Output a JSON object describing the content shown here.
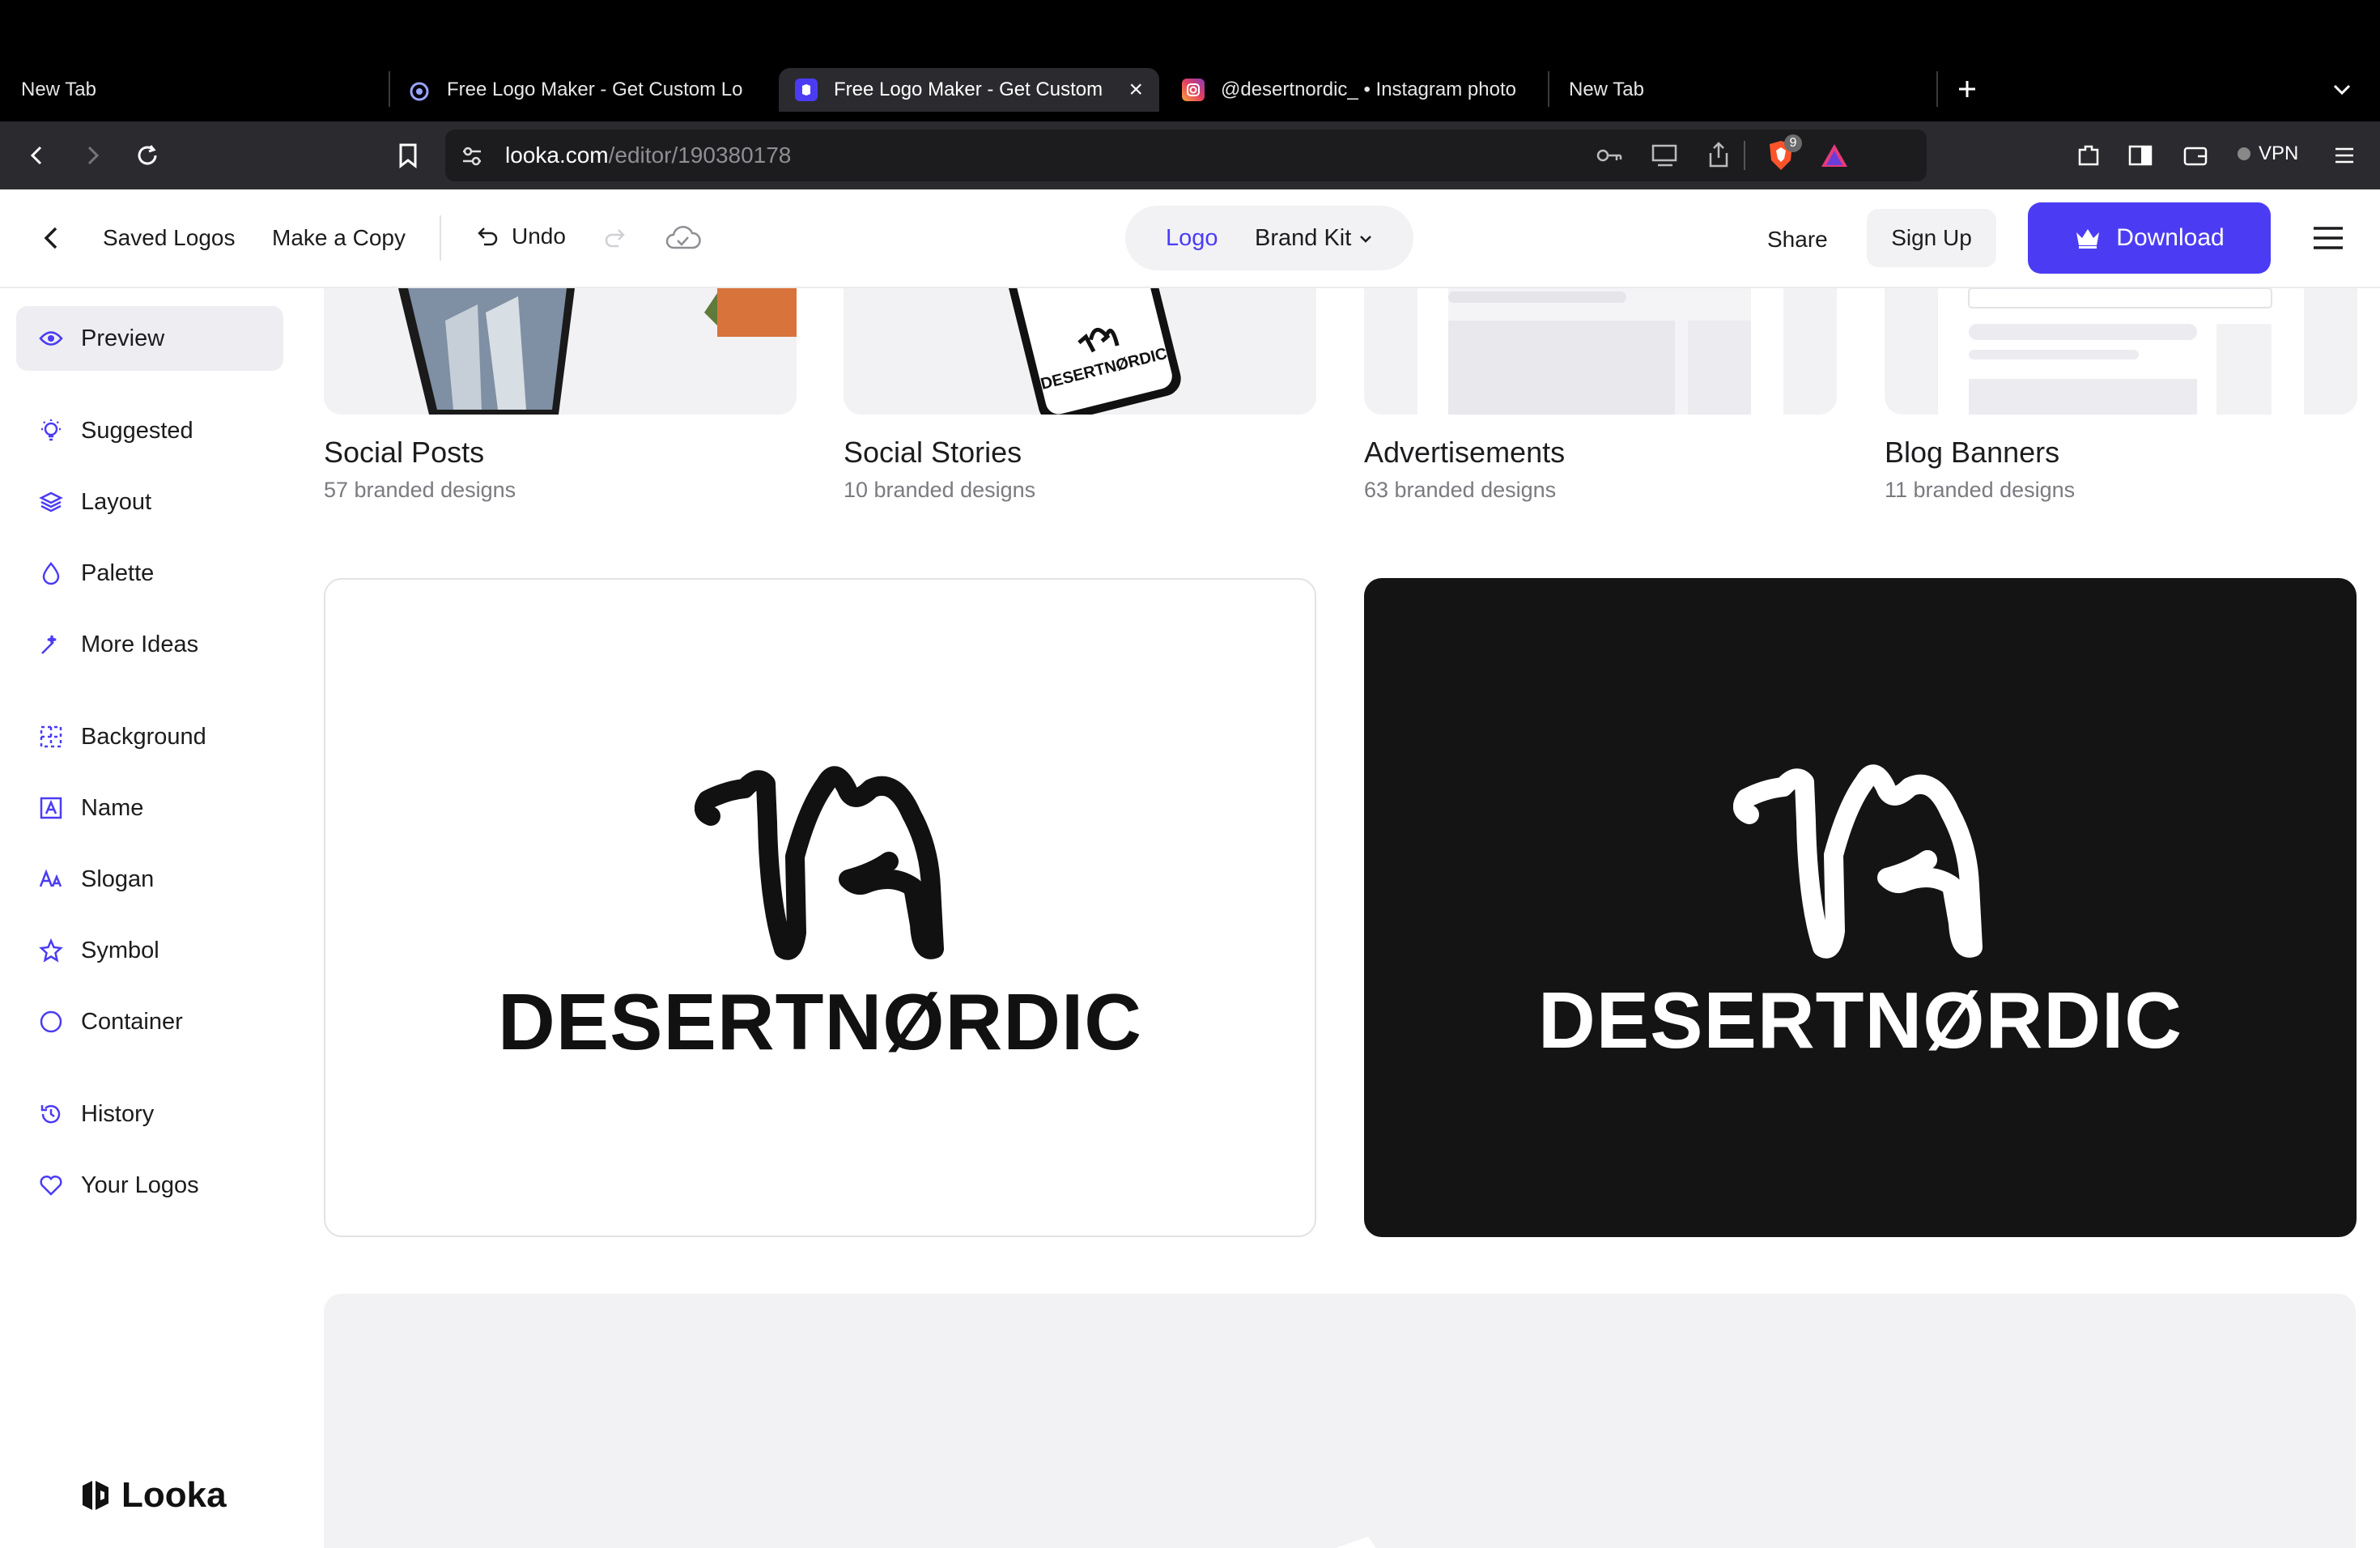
{
  "browser": {
    "tabs": [
      {
        "label": "New Tab",
        "icon": "none",
        "active": false
      },
      {
        "label": "Free Logo Maker - Get Custom Lo",
        "icon": "looka-eye-icon",
        "active": false
      },
      {
        "label": "Free Logo Maker - Get Custom",
        "icon": "looka-icon",
        "active": true
      },
      {
        "label": "@desertnordic_ • Instagram photo",
        "icon": "instagram-icon",
        "active": false
      },
      {
        "label": "New Tab",
        "icon": "none",
        "active": false
      }
    ],
    "url_host": "looka.com",
    "url_path": "/editor/190380178",
    "shields_badge": "9",
    "vpn_label": "VPN"
  },
  "header": {
    "saved_logos": "Saved Logos",
    "make_copy": "Make a Copy",
    "undo": "Undo",
    "toggle": {
      "logo": "Logo",
      "brand_kit": "Brand Kit"
    },
    "share": "Share",
    "sign_up": "Sign Up",
    "download": "Download"
  },
  "sidebar": {
    "items": [
      {
        "label": "Preview",
        "icon": "eye-icon"
      },
      {
        "label": "Suggested",
        "icon": "lightbulb-icon"
      },
      {
        "label": "Layout",
        "icon": "layers-icon"
      },
      {
        "label": "Palette",
        "icon": "droplet-icon"
      },
      {
        "label": "More Ideas",
        "icon": "magic-wand-icon"
      },
      {
        "label": "Background",
        "icon": "background-grid-icon"
      },
      {
        "label": "Name",
        "icon": "text-box-icon"
      },
      {
        "label": "Slogan",
        "icon": "font-size-icon"
      },
      {
        "label": "Symbol",
        "icon": "star-icon"
      },
      {
        "label": "Container",
        "icon": "circle-icon"
      },
      {
        "label": "History",
        "icon": "history-icon"
      },
      {
        "label": "Your Logos",
        "icon": "heart-icon"
      }
    ],
    "brand": "Looka"
  },
  "categories": [
    {
      "title": "Social Posts",
      "subtitle": "57 branded designs"
    },
    {
      "title": "Social Stories",
      "subtitle": "10 branded designs"
    },
    {
      "title": "Advertisements",
      "subtitle": "63 branded designs"
    },
    {
      "title": "Blog Banners",
      "subtitle": "11 branded designs"
    }
  ],
  "story_preview_text": "DESERTNØRDIC",
  "logo_previews": {
    "light": {
      "wordmark": "DESERTNØRDIC",
      "background": "#ffffff",
      "foreground": "#111111"
    },
    "dark": {
      "wordmark": "DESERTNØRDIC",
      "background": "#141414",
      "foreground": "#ffffff"
    }
  },
  "colors": {
    "accent": "#4b3cf4"
  }
}
